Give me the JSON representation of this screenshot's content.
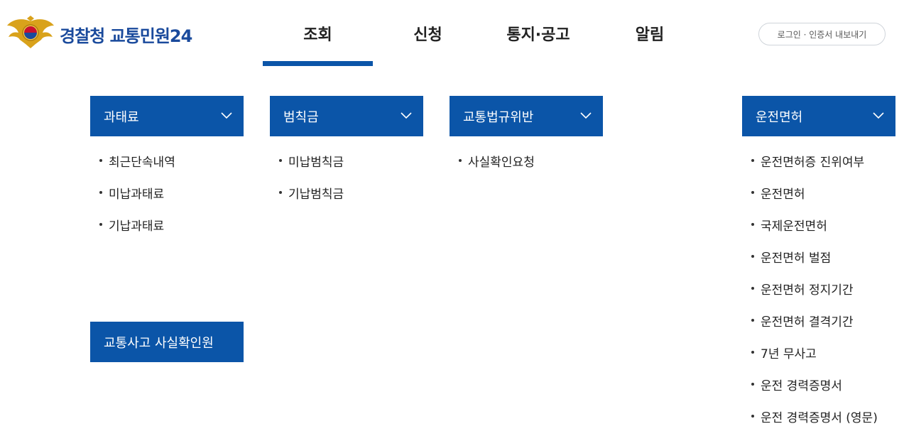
{
  "header": {
    "logo_text": "경찰청 교통민원24",
    "nav": [
      {
        "label": "조회",
        "active": true
      },
      {
        "label": "신청",
        "active": false
      },
      {
        "label": "통지·공고",
        "active": false
      },
      {
        "label": "알림",
        "active": false
      }
    ],
    "login_label": "로그인 · 인증서 내보내기"
  },
  "accent_color": "#0b55a8",
  "categories": [
    {
      "title": "과태료",
      "items": [
        "최근단속내역",
        "미납과태료",
        "기납과태료"
      ]
    },
    {
      "title": "범칙금",
      "items": [
        "미납범칙금",
        "기납범칙금"
      ]
    },
    {
      "title": "교통법규위반",
      "items": [
        "사실확인요청"
      ]
    },
    {
      "title": "운전면허",
      "items": [
        "운전면허증 진위여부",
        "운전면허",
        "국제운전면허",
        "운전면허 벌점",
        "운전면허 정지기간",
        "운전면허 결격기간",
        "7년 무사고",
        "운전 경력증명서",
        "운전 경력증명서 (영문)"
      ]
    },
    {
      "title": "교통사고 사실확인원"
    }
  ],
  "icons": {
    "emblem": "police-emblem-icon",
    "chevron": "chevron-down-icon"
  }
}
